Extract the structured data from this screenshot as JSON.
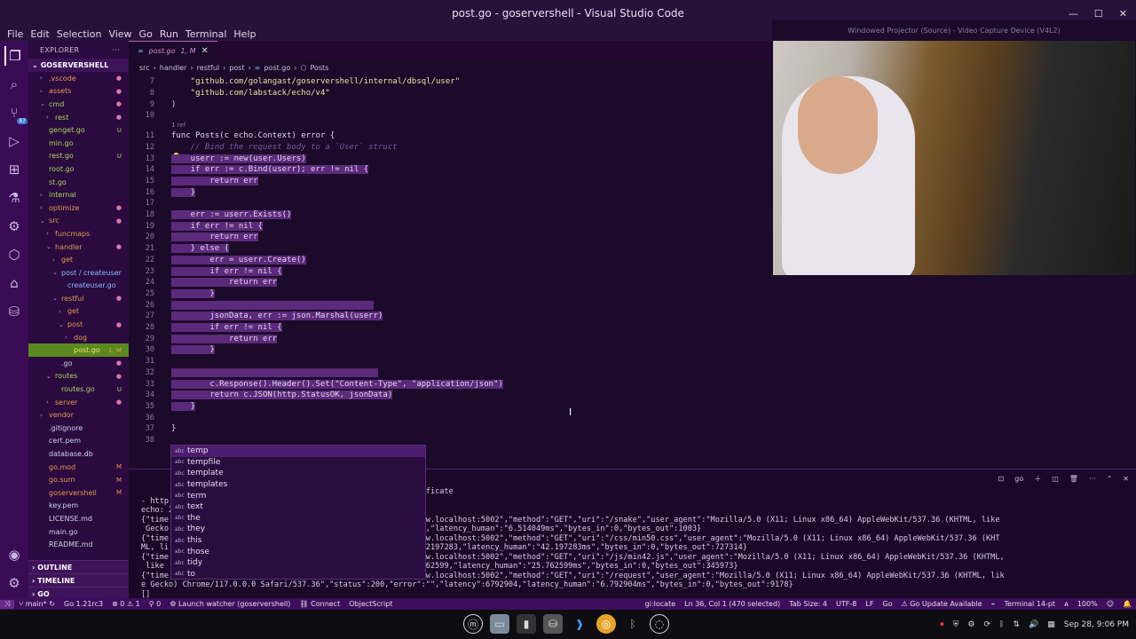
{
  "window": {
    "title": "post.go - goservershell - Visual Studio Code"
  },
  "webcam": {
    "title": "Windowed Projector (Source) - Video Capture Device (V4L2)"
  },
  "menu": [
    "File",
    "Edit",
    "Selection",
    "View",
    "Go",
    "Run",
    "Terminal",
    "Help"
  ],
  "activity": {
    "badge": "87"
  },
  "sidebar": {
    "header": "EXPLORER",
    "more": "···",
    "root": "GOSERVERSHELL",
    "items": [
      {
        "label": ".vscode",
        "depth": 1,
        "folder": true,
        "color": "orange",
        "badge": "●"
      },
      {
        "label": "assets",
        "depth": 1,
        "folder": true,
        "color": "orange",
        "badge": "●"
      },
      {
        "label": "cmd",
        "depth": 1,
        "folder": true,
        "open": true,
        "color": "green",
        "badge": "●"
      },
      {
        "label": "rest",
        "depth": 2,
        "folder": true,
        "color": "green",
        "badge": "●"
      },
      {
        "label": "genget.go",
        "depth": 1,
        "color": "green",
        "badge": "U"
      },
      {
        "label": "min.go",
        "depth": 1,
        "color": "green",
        "badge": ""
      },
      {
        "label": "rest.go",
        "depth": 1,
        "color": "green",
        "badge": "U"
      },
      {
        "label": "root.go",
        "depth": 1,
        "color": "green",
        "badge": ""
      },
      {
        "label": "st.go",
        "depth": 1,
        "color": "green",
        "badge": ""
      },
      {
        "label": "internal",
        "depth": 1,
        "folder": true,
        "color": "green",
        "badge": ""
      },
      {
        "label": "optimize",
        "depth": 1,
        "folder": true,
        "color": "orange",
        "badge": "●"
      },
      {
        "label": "src",
        "depth": 1,
        "folder": true,
        "open": true,
        "color": "orange",
        "badge": "●"
      },
      {
        "label": "funcmaps",
        "depth": 2,
        "folder": true,
        "color": "orange",
        "badge": ""
      },
      {
        "label": "handler",
        "depth": 2,
        "folder": true,
        "open": true,
        "color": "orange",
        "badge": "●"
      },
      {
        "label": "get",
        "depth": 3,
        "folder": true,
        "color": "orange",
        "badge": ""
      },
      {
        "label": "post / createuser",
        "depth": 3,
        "folder": true,
        "open": true,
        "color": "blue",
        "badge": ""
      },
      {
        "label": "createuser.go",
        "depth": 4,
        "color": "blue",
        "badge": ""
      },
      {
        "label": "restful",
        "depth": 3,
        "folder": true,
        "open": true,
        "color": "orange",
        "badge": "●"
      },
      {
        "label": "get",
        "depth": 4,
        "folder": true,
        "color": "orange",
        "badge": ""
      },
      {
        "label": "post",
        "depth": 4,
        "folder": true,
        "open": true,
        "color": "orange",
        "badge": "●"
      },
      {
        "label": "dog",
        "depth": 5,
        "folder": true,
        "color": "orange",
        "badge": ""
      },
      {
        "label": "post.go",
        "depth": 5,
        "color": "orange",
        "badge": "1, M",
        "selected": true
      },
      {
        "label": ".go",
        "depth": 3,
        "color": "plain",
        "badge": "●"
      },
      {
        "label": "routes",
        "depth": 2,
        "folder": true,
        "open": true,
        "color": "green",
        "badge": "●"
      },
      {
        "label": "routes.go",
        "depth": 3,
        "color": "green",
        "badge": "U"
      },
      {
        "label": "server",
        "depth": 2,
        "folder": true,
        "color": "orange",
        "badge": "●"
      },
      {
        "label": "vendor",
        "depth": 1,
        "folder": true,
        "color": "orange",
        "badge": ""
      },
      {
        "label": ".gitignore",
        "depth": 1,
        "color": "plain",
        "badge": ""
      },
      {
        "label": "cert.pem",
        "depth": 1,
        "color": "plain",
        "badge": ""
      },
      {
        "label": "database.db",
        "depth": 1,
        "color": "plain",
        "badge": ""
      },
      {
        "label": "go.mod",
        "depth": 1,
        "color": "orange",
        "badge": "M"
      },
      {
        "label": "go.sum",
        "depth": 1,
        "color": "orange",
        "badge": "M"
      },
      {
        "label": "goservershell",
        "depth": 1,
        "color": "orange",
        "badge": "M"
      },
      {
        "label": "key.pem",
        "depth": 1,
        "color": "plain",
        "badge": ""
      },
      {
        "label": "LICENSE.md",
        "depth": 1,
        "color": "plain",
        "badge": ""
      },
      {
        "label": "main.go",
        "depth": 1,
        "color": "plain",
        "badge": ""
      },
      {
        "label": "README.md",
        "depth": 1,
        "color": "plain",
        "badge": ""
      }
    ],
    "outline": "OUTLINE",
    "timeline": "TIMELINE",
    "go": "GO"
  },
  "tab": {
    "label": "post.go",
    "status": "1, M"
  },
  "breadcrumb": [
    "src",
    "handler",
    "restful",
    "post",
    "post.go",
    "Posts"
  ],
  "code": {
    "codelens": "1 ref",
    "lines": [
      {
        "n": "7",
        "text": "    \"github.com/golangast/goservershell/internal/dbsql/user\"",
        "cls": "s"
      },
      {
        "n": "8",
        "text": "    \"github.com/labstack/echo/v4\"",
        "cls": "s"
      },
      {
        "n": "9",
        "text": ")",
        "cls": ""
      },
      {
        "n": "10",
        "text": "",
        "cls": ""
      },
      {
        "n": "11",
        "text": "func Posts(c echo.Context) error {",
        "cls": ""
      },
      {
        "n": "12",
        "text": "    // Bind the request body to a `User` struct",
        "cls": "cm"
      },
      {
        "n": "13",
        "text": "    userr := new(user.Users)",
        "cls": "hl"
      },
      {
        "n": "14",
        "text": "    if err := c.Bind(userr); err != nil {",
        "cls": "hl"
      },
      {
        "n": "15",
        "text": "        return err",
        "cls": "hl"
      },
      {
        "n": "16",
        "text": "    }",
        "cls": "hl"
      },
      {
        "n": "17",
        "text": "",
        "cls": ""
      },
      {
        "n": "18",
        "text": "    err := userr.Exists()",
        "cls": "hl"
      },
      {
        "n": "19",
        "text": "    if err != nil {",
        "cls": "hl"
      },
      {
        "n": "20",
        "text": "        return err",
        "cls": "hl"
      },
      {
        "n": "21",
        "text": "    } else {",
        "cls": "hl"
      },
      {
        "n": "22",
        "text": "        err = userr.Create()",
        "cls": "hl"
      },
      {
        "n": "23",
        "text": "        if err != nil {",
        "cls": "hl"
      },
      {
        "n": "24",
        "text": "            return err",
        "cls": "hl"
      },
      {
        "n": "25",
        "text": "        }",
        "cls": "hl"
      },
      {
        "n": "26",
        "text": "                                          ",
        "cls": "hl"
      },
      {
        "n": "27",
        "text": "        jsonData, err := json.Marshal(userr)",
        "cls": "hl"
      },
      {
        "n": "28",
        "text": "        if err != nil {",
        "cls": "hl"
      },
      {
        "n": "29",
        "text": "            return err",
        "cls": "hl"
      },
      {
        "n": "30",
        "text": "        }",
        "cls": "hl"
      },
      {
        "n": "31",
        "text": "",
        "cls": ""
      },
      {
        "n": "32",
        "text": "                                           ",
        "cls": "hl"
      },
      {
        "n": "33",
        "text": "        c.Response().Header().Set(\"Content-Type\", \"application/json\")",
        "cls": "hl"
      },
      {
        "n": "34",
        "text": "        return c.JSON(http.StatusOK, jsonData)",
        "cls": "hl"
      },
      {
        "n": "35",
        "text": "    }",
        "cls": "hl"
      },
      {
        "n": "36",
        "text": "",
        "cls": ""
      },
      {
        "n": "37",
        "text": "}",
        "cls": ""
      },
      {
        "n": "38",
        "text": "",
        "cls": ""
      }
    ]
  },
  "suggestions": [
    "temp",
    "tempfile",
    "template",
    "templates",
    "term",
    "text",
    "the",
    "they",
    "this",
    "those",
    "tidy",
    "to"
  ],
  "panel": {
    "go_label": "go",
    "lines": [
      "                                        or: tls: unknown certificate",
      "- http",
      "echo: 2",
      "{\"time                                  e_ip\":\"::1\",\"host\":\"www.localhost:5002\",\"method\":\"GET\",\"uri\":\"/snake\",\"user_agent\":\"Mozilla/5.0 (X11; Linux x86_64) AppleWebKit/537.36 (KHTML, like",
      " Gecko                                  \":\"\",\"latency\":6514049,\"latency_human\":\"6.514049ms\",\"bytes_in\":0,\"bytes_out\":1003}",
      "{\"time                                  e_ip\":\"::1\",\"host\":\"www.localhost:5002\",\"method\":\"GET\",\"uri\":\"/css/min50.css\",\"user_agent\":\"Mozilla/5.0 (X11; Linux x86_64) AppleWebKit/537.36 (KHT",
      "ML, li                                  \"error\":\"\",\"latency\":42197283,\"latency_human\":\"42.197283ms\",\"bytes_in\":0,\"bytes_out\":727314}",
      "{\"time                                  e_ip\":\"::1\",\"host\":\"www.localhost:5002\",\"method\":\"GET\",\"uri\":\"/js/min42.js\",\"user_agent\":\"Mozilla/5.0 (X11; Linux x86_64) AppleWebKit/537.36 (KHTML,",
      " like                                   rror\":\"\",\"latency\":25762599,\"latency_human\":\"25.762599ms\",\"bytes_in\":0,\"bytes_out\":345973}",
      "{\"time                                  e_ip\":\"::1\",\"host\":\"www.localhost:5002\",\"method\":\"GET\",\"uri\":\"/request\",\"user_agent\":\"Mozilla/5.0 (X11; Linux x86_64) AppleWebKit/537.36 (KHTML, lik",
      "e Gecko) Chrome/117.0.0.0 Safari/537.36\",\"status\":200,\"error\":\"\",\"latency\":6792904,\"latency_human\":\"6.792904ms\",\"bytes_in\":0,\"bytes_out\":9178}",
      "[]"
    ]
  },
  "status": {
    "branch": "main*",
    "sync": "↻",
    "go_version": "Go 1.21rc3",
    "problems": "⊗ 0 ⚠ 1",
    "ports": "⚲ 0",
    "watcher": "Launch watcher (goservershell)",
    "connect": "Connect",
    "objectscript": "ObjectScript",
    "locate": "gi:locate",
    "position": "Ln 36, Col 1 (470 selected)",
    "tab_size": "Tab Size: 4",
    "encoding": "UTF-8",
    "eol": "LF",
    "lang": "Go",
    "update": "Go Update Available",
    "terminal": "Terminal 14-pt",
    "zoom": "100%"
  },
  "taskbar": {
    "datetime": "Sep 28, 9:06 PM"
  }
}
